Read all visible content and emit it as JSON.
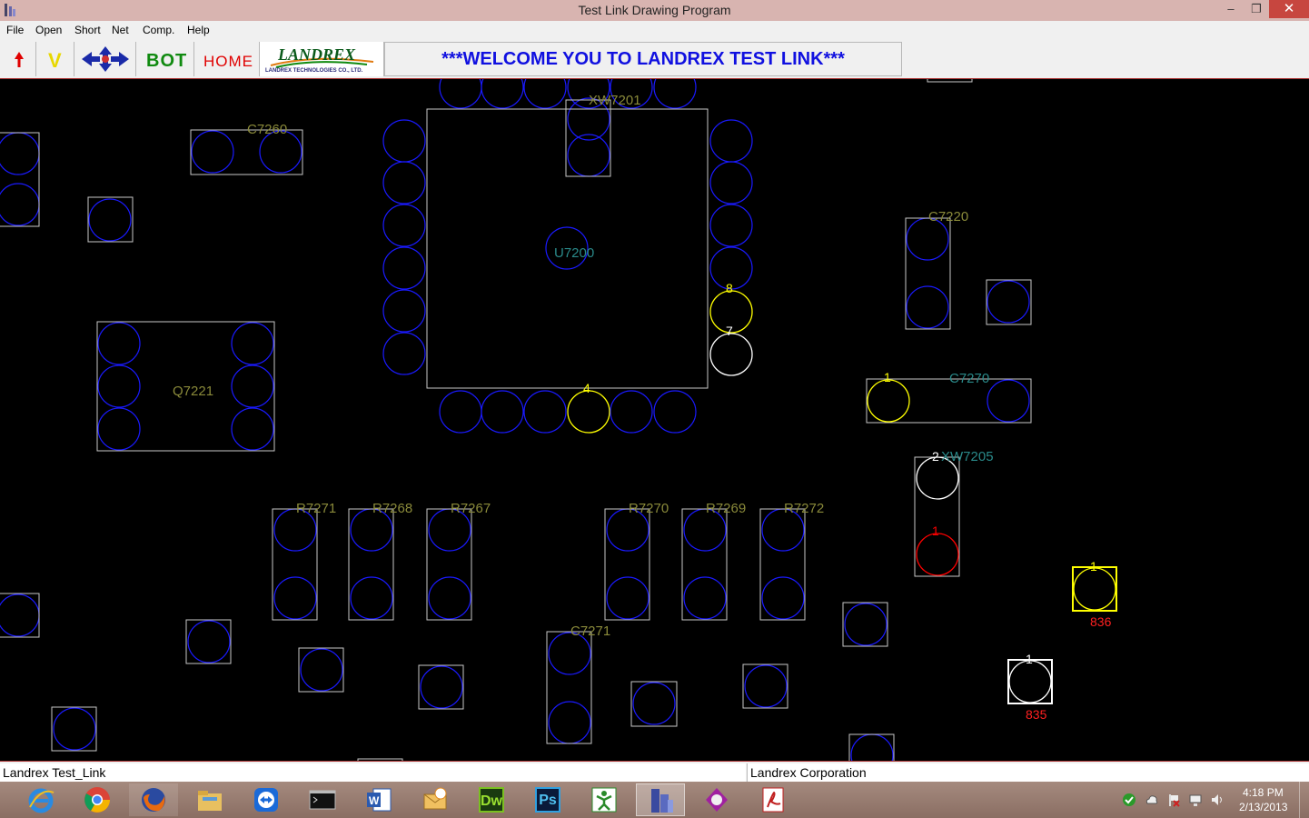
{
  "window": {
    "title": "Test Link Drawing Program",
    "minimize": "–",
    "restore": "❐",
    "close": "✕"
  },
  "menu": [
    "File",
    "Open",
    "Short",
    "Net",
    "Comp.",
    "Help"
  ],
  "toolbar": {
    "up_arrow": "up-arrow-icon",
    "v_label": "V",
    "nav_icon": "four-direction-arrows-icon",
    "bot_label": "BOT",
    "home_label": "HOME",
    "logo_text": "LANDREX",
    "logo_subtext": "LANDREX TECHNOLOGIES CO., LTD.",
    "welcome": "***WELCOME YOU TO LANDREX TEST LINK***"
  },
  "canvas": {
    "labels": {
      "xw7201": "XW7201",
      "c7260": "C7260",
      "u7200": "U7200",
      "c7220": "C7220",
      "q7221": "Q7221",
      "c7270": "C7270",
      "xw7205": "XW7205",
      "r7271": "R7271",
      "r7268": "R7268",
      "r7267": "R7267",
      "r7270": "R7270",
      "r7269": "R7269",
      "r7272": "R7272",
      "c7271": "C7271"
    },
    "pin_numbers": {
      "p8": "8",
      "p7": "7",
      "p4": "4",
      "p1a": "1",
      "p2": "2",
      "p1b": "1",
      "p1c": "1",
      "p1d": "1"
    },
    "test_points": {
      "tp836": "836",
      "tp835": "835"
    },
    "colors": {
      "background": "#000000",
      "pad": "#1a1aff",
      "outline": "#c8c8c8",
      "label": "#8a8a3a",
      "label_alt": "#2a8a8a",
      "selected_yellow": "#ffff00",
      "selected_white": "#ffffff",
      "net_red": "#ff0000"
    }
  },
  "status": {
    "left": "Landrex Test_Link",
    "right": "Landrex Corporation"
  },
  "taskbar": {
    "apps": [
      "internet-explorer-icon",
      "chrome-icon",
      "firefox-icon",
      "file-explorer-icon",
      "teamviewer-icon",
      "command-prompt-icon",
      "word-icon",
      "outlook-icon",
      "dreamweaver-icon",
      "photoshop-icon",
      "green-app-icon",
      "buildings-app-icon",
      "purple-app-icon",
      "acrobat-icon"
    ],
    "dw": "Dw",
    "ps": "Ps",
    "time": "4:18 PM",
    "date": "2/13/2013"
  }
}
